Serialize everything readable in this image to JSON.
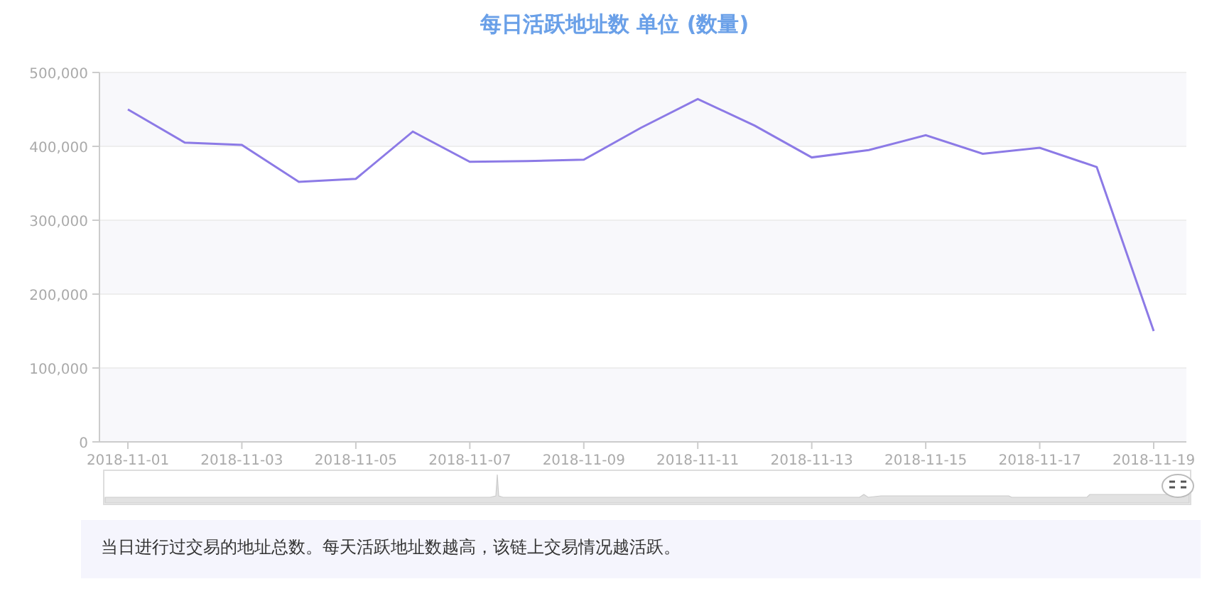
{
  "title": "每日活跃地址数 单位 (数量)",
  "chart": {
    "chart_data": {
      "type": "line",
      "categories": [
        "2018-11-01",
        null,
        "2018-11-03",
        null,
        "2018-11-05",
        null,
        "2018-11-07",
        null,
        "2018-11-09",
        null,
        "2018-11-11",
        null,
        "2018-11-13",
        null,
        "2018-11-15",
        null,
        "2018-11-17",
        null,
        "2018-11-19"
      ],
      "series": [
        {
          "color": "#8c7ae6",
          "values": [
            450000,
            405000,
            402000,
            352000,
            356000,
            420000,
            379000,
            380000,
            382000,
            425000,
            464000,
            428000,
            385000,
            395000,
            415000,
            390000,
            398000,
            372000,
            150000
          ]
        }
      ],
      "ylim": [
        0,
        500000
      ],
      "grid": true,
      "yticks": [
        {
          "value": 0,
          "label": "0"
        },
        {
          "value": 100000,
          "label": "100,000"
        },
        {
          "value": 200000,
          "label": "200,000"
        },
        {
          "value": 300000,
          "label": "300,000"
        },
        {
          "value": 400000,
          "label": "400,000"
        },
        {
          "value": 500000,
          "label": "500,000"
        }
      ]
    }
  },
  "note": "当日进行过交易的地址总数。每天活跃地址数越高，该链上交易情况越活跃。"
}
